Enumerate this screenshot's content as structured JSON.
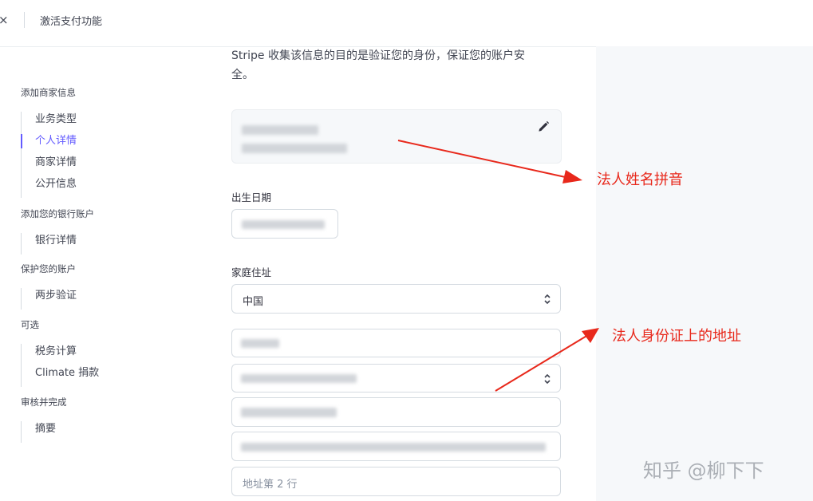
{
  "header": {
    "close_glyph": "×",
    "title": "激活支付功能"
  },
  "sidebar": {
    "sections": [
      {
        "title": "添加商家信息",
        "items": [
          {
            "label": "业务类型",
            "active": false
          },
          {
            "label": "个人详情",
            "active": true
          },
          {
            "label": "商家详情",
            "active": false
          },
          {
            "label": "公开信息",
            "active": false
          }
        ]
      },
      {
        "title": "添加您的银行账户",
        "items": [
          {
            "label": "银行详情",
            "active": false
          }
        ]
      },
      {
        "title": "保护您的账户",
        "items": [
          {
            "label": "两步验证",
            "active": false
          }
        ]
      },
      {
        "title": "可选",
        "items": [
          {
            "label": "税务计算",
            "active": false
          },
          {
            "label": "Climate 捐款",
            "active": false
          }
        ]
      },
      {
        "title": "审核并完成",
        "items": [
          {
            "label": "摘要",
            "active": false
          }
        ]
      }
    ]
  },
  "main": {
    "intro_line1": "Stripe 收集该信息的目的是验证您的身份，保证您的账户安",
    "intro_line2": "全。",
    "dob_label": "出生日期",
    "address_label": "家庭住址",
    "country_value": "中国",
    "address_line2_placeholder": "地址第 2 行"
  },
  "annotations": {
    "name_note": "法人姓名拼音",
    "address_note": "法人身份证上的地址",
    "color": "#e8281b"
  },
  "watermark": "知乎 @柳下下",
  "colors": {
    "accent": "#635bff",
    "panel_bg": "#f6f8fa"
  }
}
